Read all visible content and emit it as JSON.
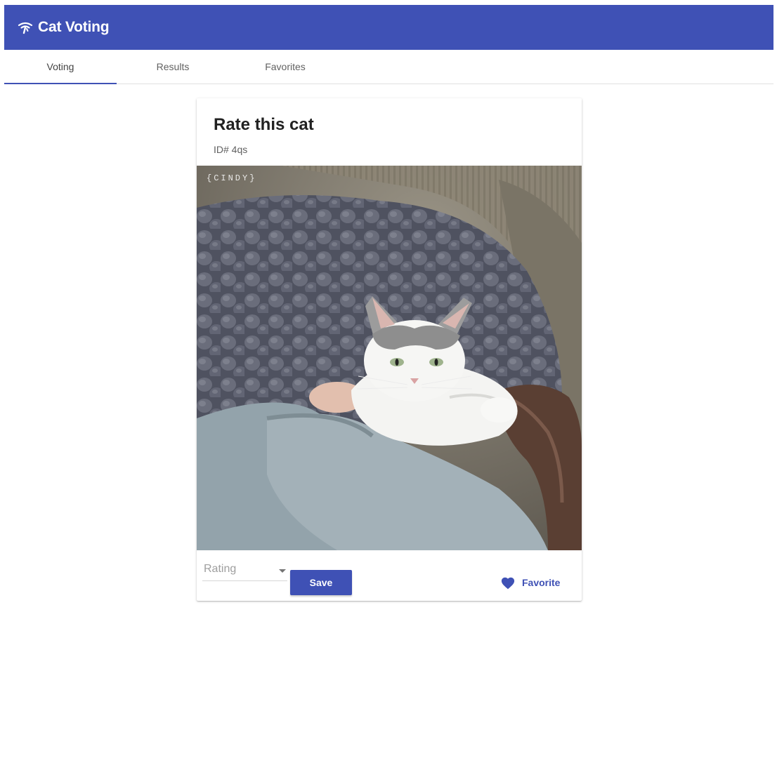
{
  "app": {
    "title": "Cat Voting",
    "brand_icon": "wifi-cat-icon",
    "accent_color": "#3f51b5"
  },
  "tabs": [
    {
      "label": "Voting",
      "active": true
    },
    {
      "label": "Results",
      "active": false
    },
    {
      "label": "Favorites",
      "active": false
    }
  ],
  "card": {
    "title": "Rate this cat",
    "subtitle": "ID# 4qs",
    "image_watermark": "{CINDY}",
    "rating": {
      "placeholder": "Rating",
      "value": ""
    },
    "save_label": "Save",
    "favorite_label": "Favorite",
    "favorite_icon": "heart-icon"
  }
}
